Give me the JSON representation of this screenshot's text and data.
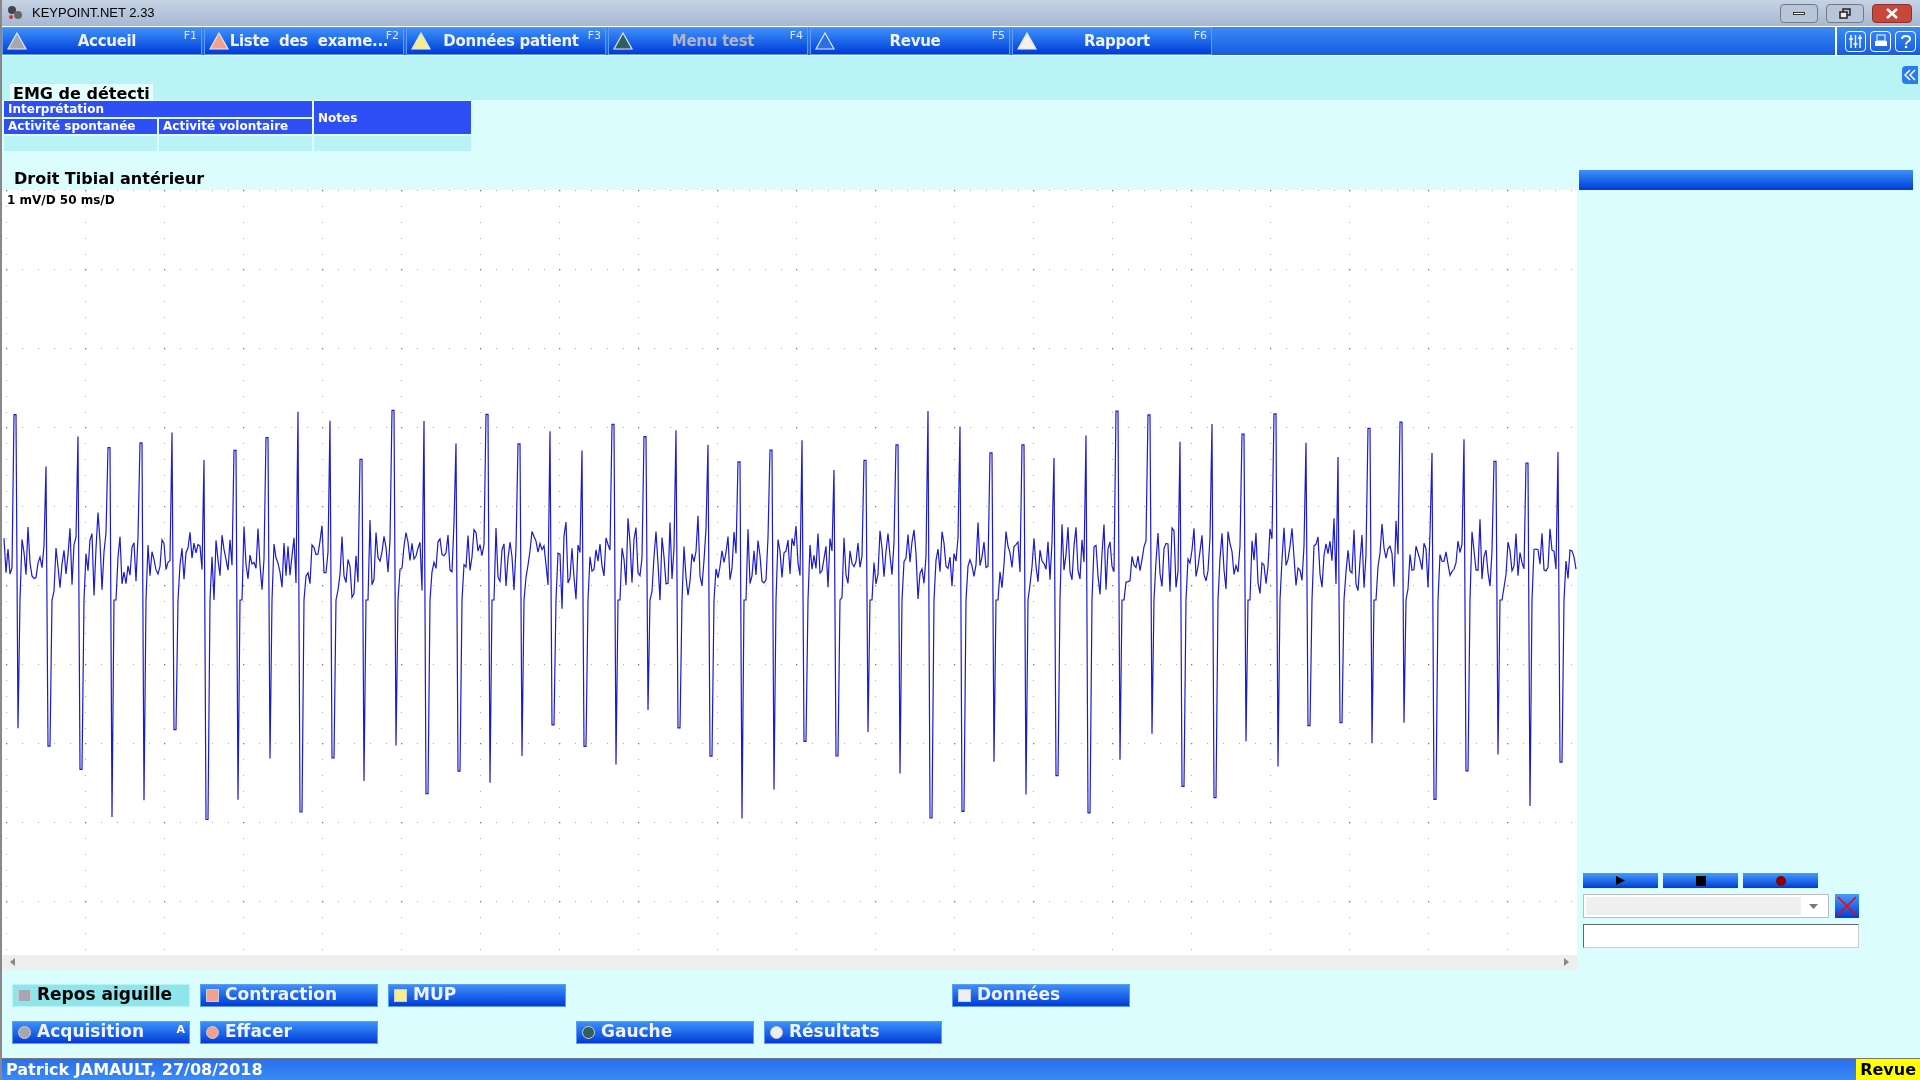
{
  "window": {
    "title": "KEYPOINT.NET 2.33"
  },
  "tabs": [
    {
      "label": "Accueil",
      "key": "F1",
      "color": "#a7a7b3",
      "disabled": false
    },
    {
      "label": "Liste  des  exame...",
      "key": "F2",
      "color": "#f4a090",
      "disabled": false
    },
    {
      "label": "Données patient",
      "key": "F3",
      "color": "#f4ee90",
      "disabled": false
    },
    {
      "label": "Menu test",
      "key": "F4",
      "color": "#2f5f5f",
      "disabled": true
    },
    {
      "label": "Revue",
      "key": "F5",
      "color": "#2a6ee8",
      "disabled": false
    },
    {
      "label": "Rapport",
      "key": "F6",
      "color": "#f4f0ea",
      "disabled": false
    }
  ],
  "exam_title": "EMG de détecti",
  "table": {
    "group": "Interprétation",
    "columns": [
      "Activité spontanée",
      "Activité volontaire"
    ],
    "notes": "Notes"
  },
  "trace": {
    "muscle": "Droit Tibial antérieur",
    "scale": "1 mV/D 50 ms/D"
  },
  "button_rows": [
    [
      {
        "label": "Repos aiguille",
        "kind": "square",
        "color": "#a7a7b3",
        "selected": true
      },
      {
        "label": "Contraction",
        "kind": "square",
        "color": "#f4a090",
        "selected": false
      },
      {
        "label": "MUP",
        "kind": "square",
        "color": "#f4ee90",
        "selected": false
      },
      {
        "label": "Données",
        "kind": "square",
        "color": "#eeeeee",
        "selected": false
      }
    ],
    [
      {
        "label": "Acquisition",
        "key": "A",
        "kind": "circle",
        "color": "#a7a7b3",
        "selected": false
      },
      {
        "label": "Effacer",
        "kind": "circle",
        "color": "#f4a090",
        "selected": false
      },
      {
        "label": "Gauche",
        "kind": "circle",
        "color": "#2f5f5f",
        "selected": false
      },
      {
        "label": "Résultats",
        "kind": "circle",
        "color": "#eeeeee",
        "selected": false
      }
    ]
  ],
  "status_bar": {
    "text": "Patrick JAMAULT, 27/08/2018",
    "mode": "Revue"
  }
}
